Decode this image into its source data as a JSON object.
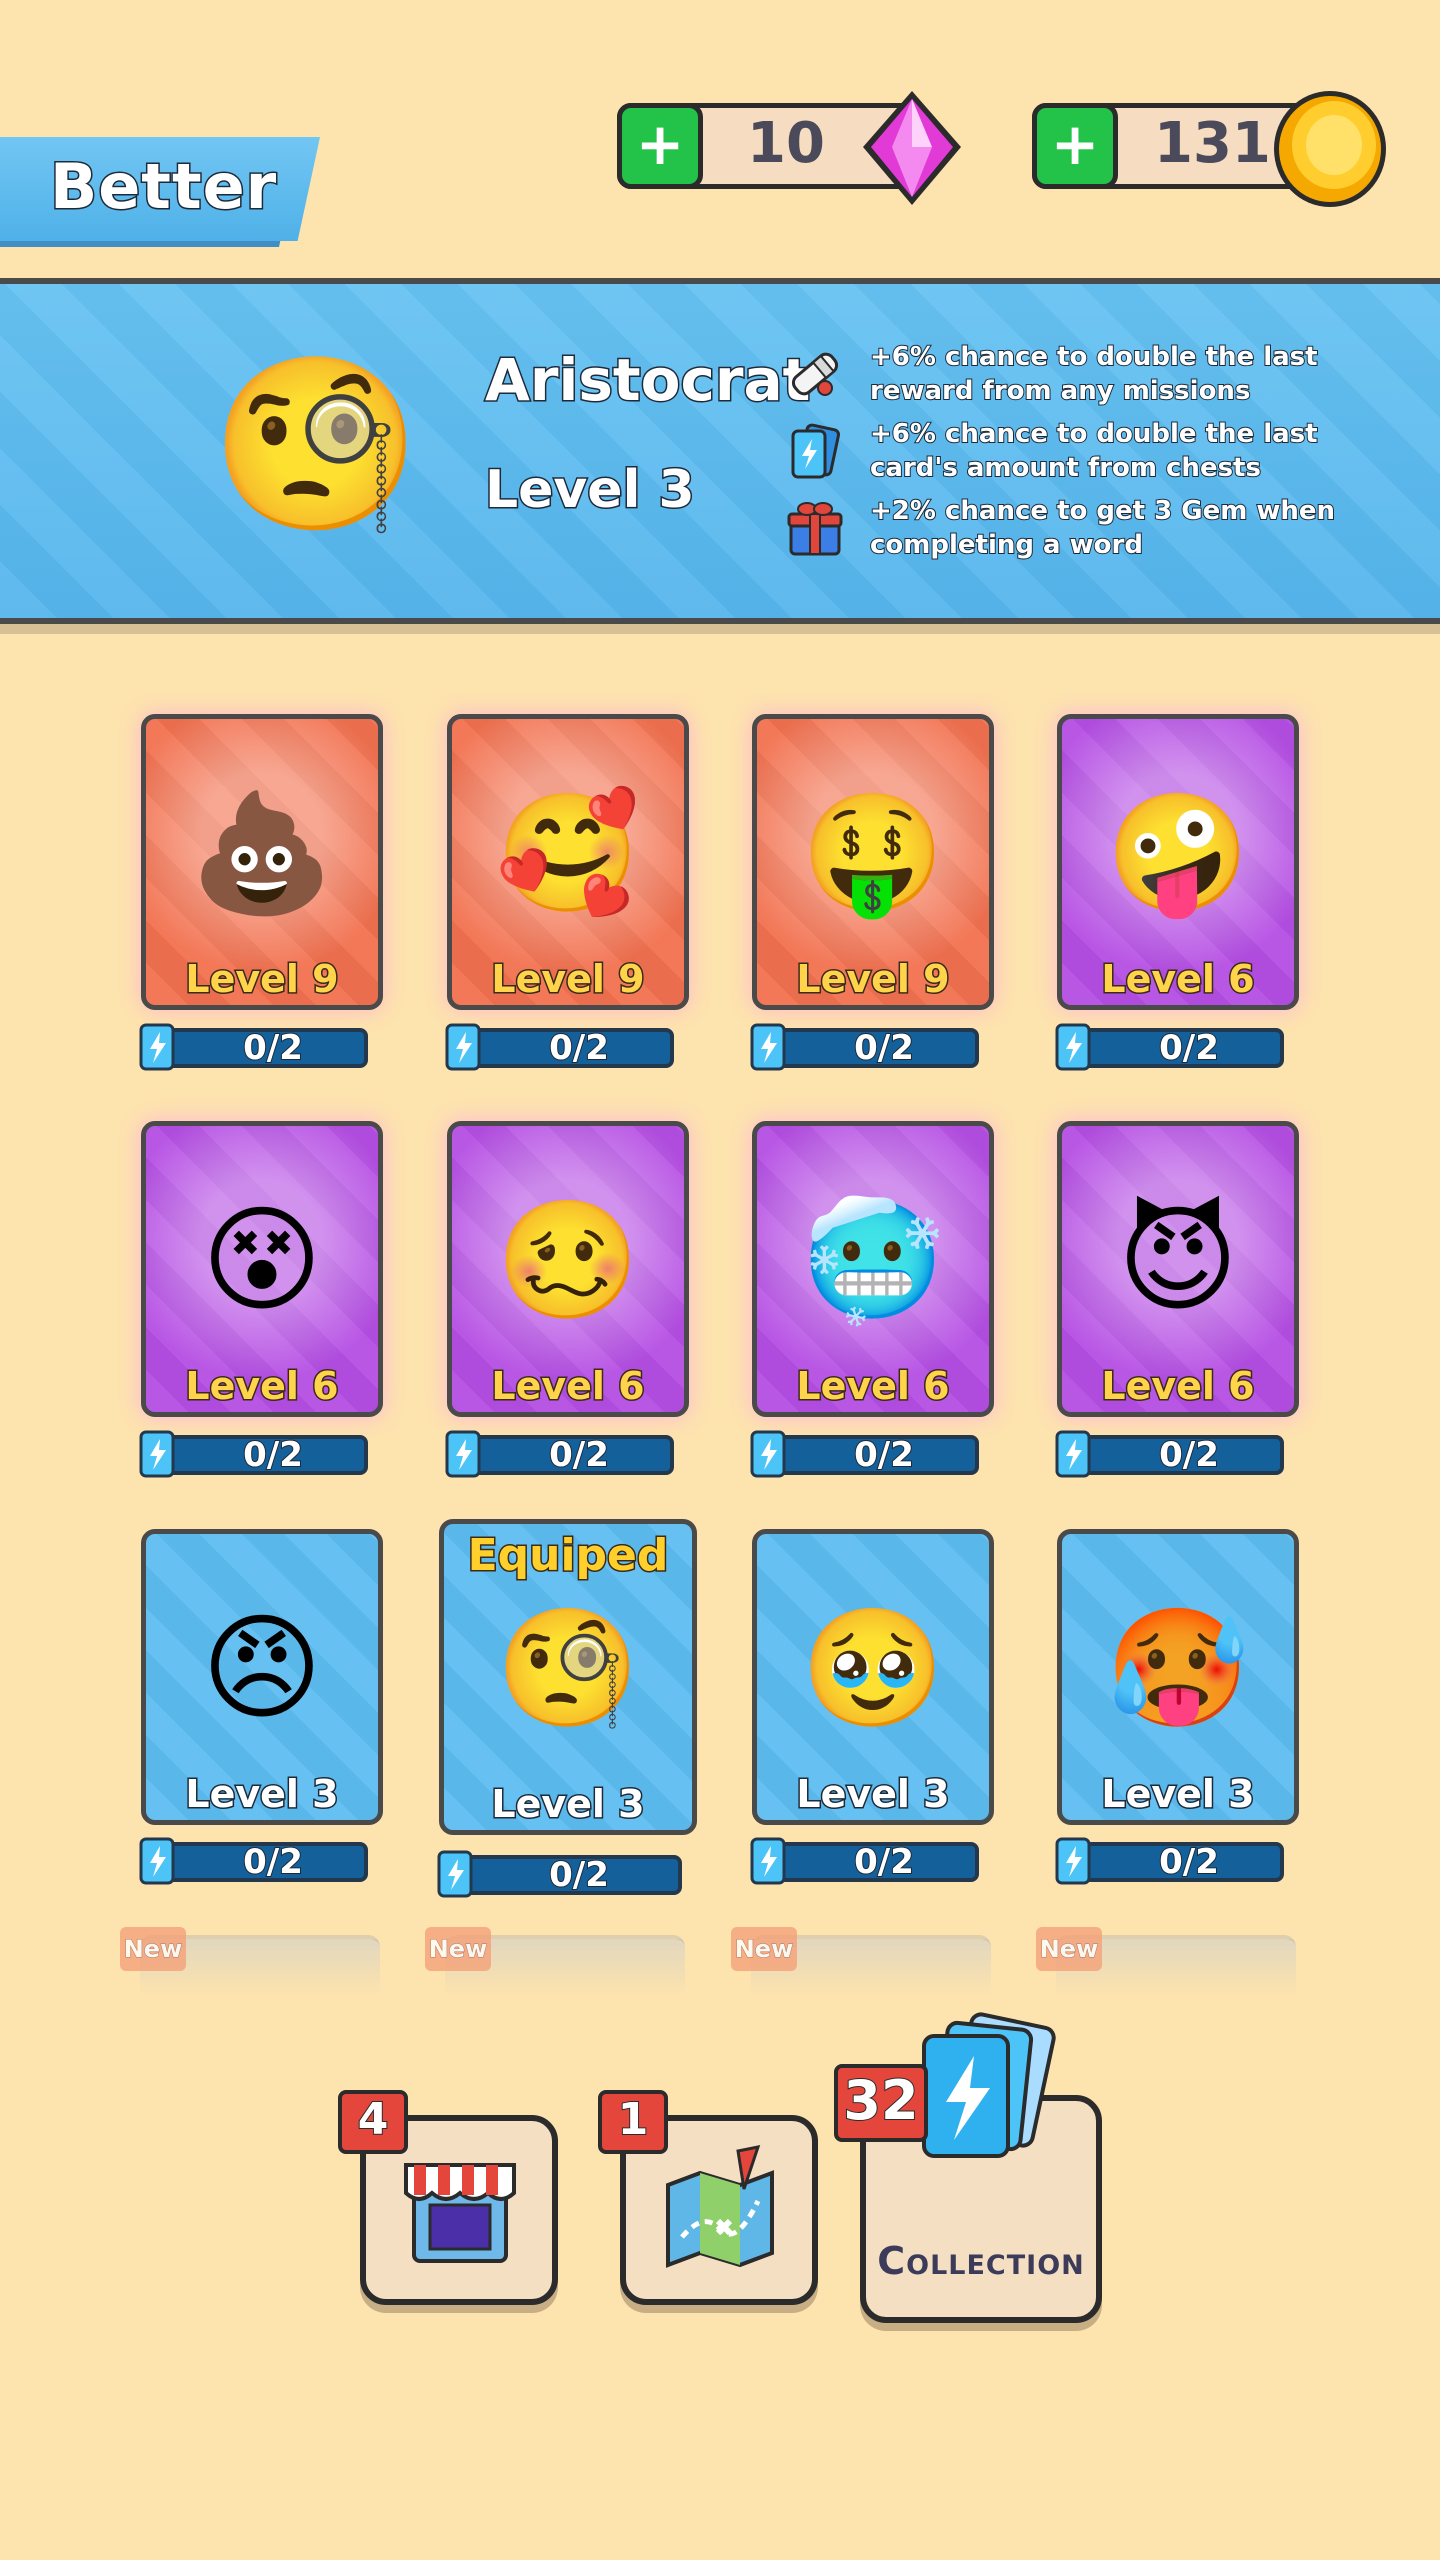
{
  "header": {
    "rank_title": "Better",
    "gems": {
      "value": "10",
      "plus_label": "+"
    },
    "coins": {
      "value": "131",
      "plus_label": "+"
    }
  },
  "profile": {
    "name": "Aristocrat",
    "level": "Level 3",
    "perks": [
      {
        "icon": "scroll-icon",
        "text": "+6% chance to double the last reward from any missions"
      },
      {
        "icon": "cards-icon",
        "text": "+6% chance to double the last card's amount from chests"
      },
      {
        "icon": "gift-icon",
        "text": "+2% chance to get 3 Gem when completing a word"
      }
    ]
  },
  "cards": [
    {
      "emoji": "💩",
      "level": "Level 9",
      "progress": "0/2",
      "rarity": "orange"
    },
    {
      "emoji": "🥰",
      "level": "Level 9",
      "progress": "0/2",
      "rarity": "orange"
    },
    {
      "emoji": "🤑",
      "level": "Level 9",
      "progress": "0/2",
      "rarity": "orange"
    },
    {
      "emoji": "🤪",
      "level": "Level 6",
      "progress": "0/2",
      "rarity": "purple"
    },
    {
      "emoji": "😵",
      "level": "Level 6",
      "progress": "0/2",
      "rarity": "purple"
    },
    {
      "emoji": "🥴",
      "level": "Level 6",
      "progress": "0/2",
      "rarity": "purple"
    },
    {
      "emoji": "🥶",
      "level": "Level 6",
      "progress": "0/2",
      "rarity": "purple"
    },
    {
      "emoji": "😈",
      "level": "Level 6",
      "progress": "0/2",
      "rarity": "purple"
    },
    {
      "emoji": "😠",
      "level": "Level 3",
      "progress": "0/2",
      "rarity": "blue"
    },
    {
      "emoji": "🧐",
      "level": "Level 3",
      "progress": "0/2",
      "rarity": "blue",
      "equipped_label": "Equiped"
    },
    {
      "emoji": "🥹",
      "level": "Level 3",
      "progress": "0/2",
      "rarity": "blue"
    },
    {
      "emoji": "🥵",
      "level": "Level 3",
      "progress": "0/2",
      "rarity": "blue"
    }
  ],
  "new_label": "New",
  "profile_emoji": "🧐",
  "nav": {
    "shop": {
      "icon": "shop-icon",
      "badge": "4"
    },
    "map": {
      "icon": "map-icon",
      "badge": "1"
    },
    "collection": {
      "icon": "collection-cards-icon",
      "badge": "32",
      "label": "Collection"
    }
  },
  "colors": {
    "background": "#fde3ae",
    "band": "#5cbdf1",
    "orange_card": "#f2714f",
    "purple_card": "#b54ee4",
    "blue_card": "#5cbdf1",
    "green_plus": "#23c248",
    "badge_red": "#e5463b"
  }
}
